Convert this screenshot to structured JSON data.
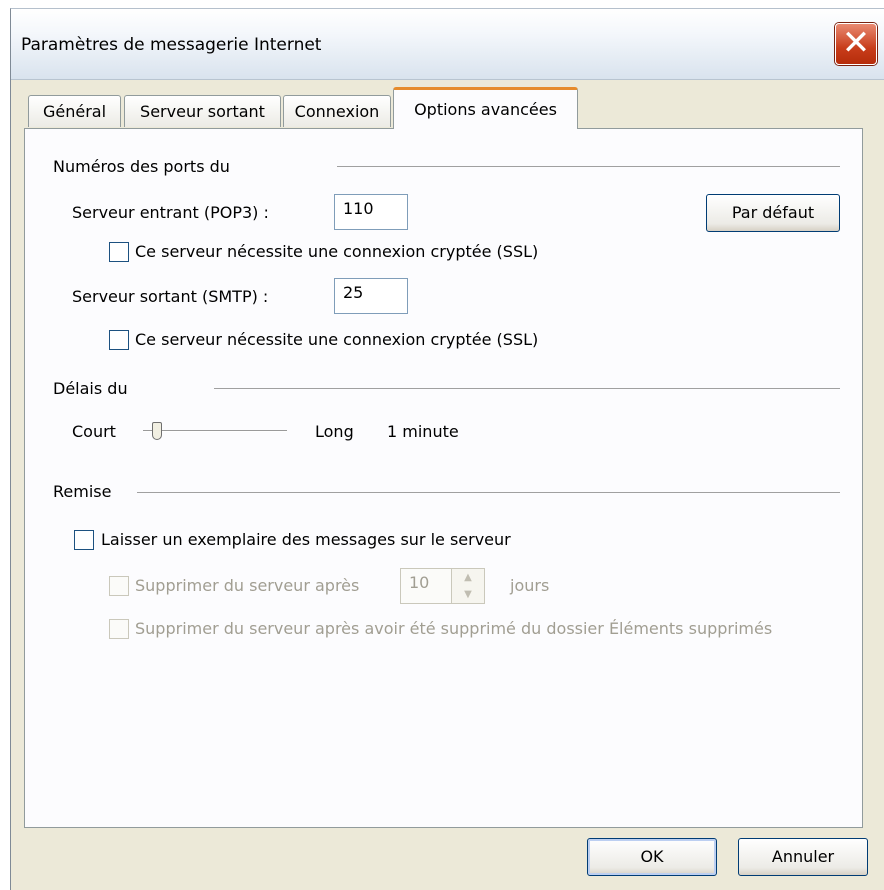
{
  "window": {
    "title": "Paramètres de messagerie Internet"
  },
  "tabs": [
    {
      "label": "Général"
    },
    {
      "label": "Serveur sortant"
    },
    {
      "label": "Connexion"
    },
    {
      "label": "Options avancées",
      "active": true
    }
  ],
  "ports": {
    "heading": "Numéros des ports du",
    "incoming_label": "Serveur entrant (POP3) :",
    "incoming_value": "110",
    "incoming_ssl_label": "Ce serveur nécessite une connexion cryptée (SSL)",
    "outgoing_label": "Serveur sortant (SMTP) :",
    "outgoing_value": "25",
    "outgoing_ssl_label": "Ce serveur nécessite une connexion cryptée (SSL)",
    "default_button": "Par défaut"
  },
  "timeout": {
    "heading": "Délais du",
    "short_label": "Court",
    "long_label": "Long",
    "value_text": "1 minute",
    "slider_level": 0.1
  },
  "delivery": {
    "heading": "Remise",
    "leave_copy_label": "Laisser un exemplaire des messages sur le serveur",
    "remove_after_label": "Supprimer du serveur après",
    "remove_after_value": "10",
    "days_label": "jours",
    "remove_when_deleted_label": "Supprimer du serveur après avoir été supprimé du dossier Éléments supprimés"
  },
  "buttons": {
    "ok": "OK",
    "cancel": "Annuler"
  },
  "icons": {
    "close": "close-icon",
    "spin_up": "spin-up-icon",
    "spin_down": "spin-down-icon"
  }
}
